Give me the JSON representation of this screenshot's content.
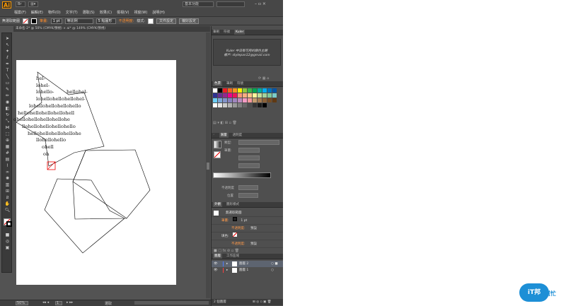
{
  "app": {
    "logo": "Ai",
    "doc_mode": "基本功能",
    "search_placeholder": "",
    "menu": [
      "檔案(F)",
      "編輯(E)",
      "物件(O)",
      "文字(T)",
      "選取(S)",
      "效果(C)",
      "檢視(V)",
      "視窗(W)",
      "說明(H)"
    ]
  },
  "control_bar": {
    "selection": "無選取範圍",
    "stroke_label": "筆畫:",
    "stroke_value": "1 pt",
    "stroke_style": "等比例",
    "brush": "5 點圓形",
    "opacity_label": "不透明度:",
    "style_label": "樣式:",
    "doc_setup": "文件設定",
    "prefs": "偏好設定"
  },
  "tab": {
    "label": "未命名-2* @ 50% (CMYK/預視)   ×   ai* @ 149% (CMYK/預視)"
  },
  "canvas": {
    "text_lines": [
      "hel-",
      "lohel-",
      "lohello-",
      "hellohel-",
      "lohellohellohellohel-",
      "lohellohellohellohello",
      "hellohellohellohellohell",
      "ohellohellohellohellohe",
      "llohellohellohellohello",
      "hellohellohellohellohe",
      "llohellohello",
      "lohelloh",
      "ellohell",
      "ohell",
      "oh"
    ]
  },
  "status": {
    "zoom": "50%",
    "page": "1",
    "tool": "選取"
  },
  "panels": {
    "kuler_tabs": [
      "筆刷",
      "符號",
      "Kuler"
    ],
    "kuler_msg_1": "Kuler 中沒有可用的顏色主題",
    "kuler_msg_2": "帳戶: stylepan12@gmail.com",
    "swatch_tabs": [
      "色票",
      "筆刷",
      "符號"
    ],
    "grad_tabs": [
      "漸層",
      "透明度"
    ],
    "grad_type_label": "類型:",
    "stroke_label": "筆畫:",
    "opacity_label": "不透明度",
    "location_label": "位置",
    "appearance_tabs": [
      "外觀",
      "圖形樣式"
    ],
    "appearance_title": "無選取範圍",
    "appearance_rows": [
      {
        "label": "筆畫:",
        "value": "1 pt"
      },
      {
        "label": "不透明度:",
        "value": "預設"
      },
      {
        "label": "填色:",
        "value": ""
      },
      {
        "label": "不透明度:",
        "value": "預設"
      }
    ],
    "layers_tabs": [
      "圖層",
      "工作區域"
    ],
    "layers": [
      {
        "name": "圖層 2"
      },
      {
        "name": "圖層 1"
      }
    ],
    "layers_count": "2 個圖層"
  },
  "watermark": {
    "logo_a": "iT邦",
    "logo_b": "幫忙"
  },
  "colors": {
    "swatches": [
      "#ffffff",
      "#000000",
      "#ed1c24",
      "#f26522",
      "#f7941d",
      "#fff200",
      "#8dc63f",
      "#39b54a",
      "#00a651",
      "#00a99d",
      "#00aeef",
      "#0072bc",
      "#0054a6",
      "#2e3192",
      "#662d91",
      "#92278f",
      "#ec008c",
      "#ed145b",
      "#f7977a",
      "#f9ad81",
      "#fdc689",
      "#fff79a",
      "#c4df9b",
      "#a3d39c",
      "#82ca9d",
      "#7accc8",
      "#6dcff6",
      "#7da7d9",
      "#8393ca",
      "#8781bd",
      "#a186be",
      "#bd8cbf",
      "#f49ac2",
      "#f6989d",
      "#c69c6d",
      "#a67c52",
      "#8c6239",
      "#754c24",
      "#603913",
      "#ffffff",
      "#e6e6e6",
      "#cccccc",
      "#b3b3b3",
      "#999999",
      "#808080",
      "#666666",
      "#4d4d4d",
      "#333333",
      "#1a1a1a",
      "#000000"
    ]
  }
}
